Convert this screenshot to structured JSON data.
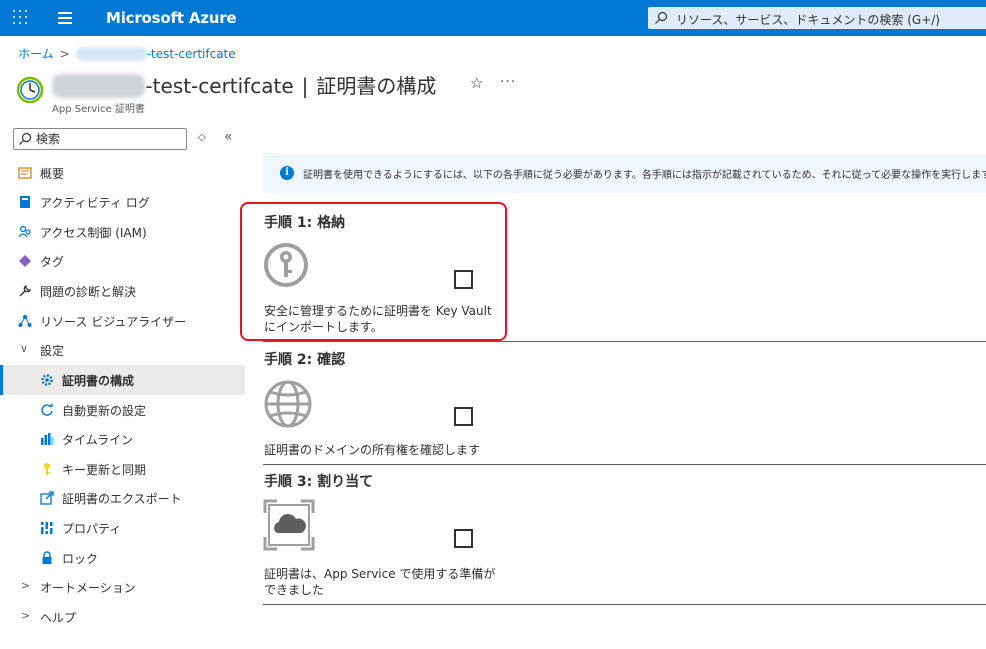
{
  "topbar": {
    "brand": "Microsoft Azure",
    "search_placeholder": "リソース、サービス、ドキュメントの検索 (G+/)"
  },
  "breadcrumb": {
    "home": "ホーム",
    "resource": "-test-certifcate"
  },
  "header": {
    "title_suffix": "-test-certifcate",
    "separator": "|",
    "section": "証明書の構成",
    "subtitle": "App Service 証明書"
  },
  "sidebar": {
    "search_placeholder": "検索",
    "items": [
      {
        "label": "概要",
        "icon": "overview-icon"
      },
      {
        "label": "アクティビティ ログ",
        "icon": "activity-log-icon"
      },
      {
        "label": "アクセス制御 (IAM)",
        "icon": "iam-icon"
      },
      {
        "label": "タグ",
        "icon": "tag-icon"
      },
      {
        "label": "問題の診断と解決",
        "icon": "wrench-icon"
      },
      {
        "label": "リソース ビジュアライザー",
        "icon": "visualizer-icon"
      },
      {
        "label": "設定",
        "icon": "chevron-down-icon"
      },
      {
        "label": "証明書の構成",
        "icon": "gear-icon"
      },
      {
        "label": "自動更新の設定",
        "icon": "refresh-icon"
      },
      {
        "label": "タイムライン",
        "icon": "timeline-icon"
      },
      {
        "label": "キー更新と同期",
        "icon": "key-icon"
      },
      {
        "label": "証明書のエクスポート",
        "icon": "export-icon"
      },
      {
        "label": "プロパティ",
        "icon": "properties-icon"
      },
      {
        "label": "ロック",
        "icon": "lock-icon"
      },
      {
        "label": "オートメーション",
        "icon": "chevron-right-icon"
      },
      {
        "label": "ヘルプ",
        "icon": "chevron-right-icon"
      }
    ]
  },
  "banner": {
    "text": "証明書を使用できるようにするには、以下の各手順に従う必要があります。各手順には指示が記載されているため、それに従って必要な操作を実行します。"
  },
  "steps": [
    {
      "title": "手順 1: 格納",
      "desc": "安全に管理するために証明書を Key Vault にインポートします。",
      "icon": "key-vault-icon"
    },
    {
      "title": "手順 2: 確認",
      "desc": "証明書のドメインの所有権を確認します",
      "icon": "globe-icon"
    },
    {
      "title": "手順 3: 割り当て",
      "desc": "証明書は、App Service で使用する準備ができました",
      "icon": "cloud-assign-icon"
    }
  ],
  "colors": {
    "azure_blue": "#0078d4",
    "highlight_red": "#e81123"
  }
}
